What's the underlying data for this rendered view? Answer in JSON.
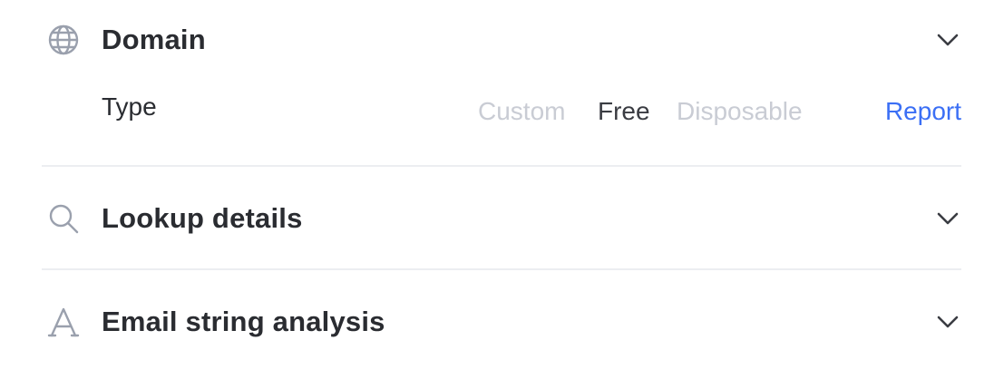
{
  "sections": [
    {
      "title": "Domain",
      "icon": "globe-icon",
      "expanded": true,
      "type_row": {
        "label": "Type",
        "options": [
          {
            "label": "Custom",
            "active": false
          },
          {
            "label": "Free",
            "active": true
          },
          {
            "label": "Disposable",
            "active": false
          }
        ],
        "action_label": "Report"
      }
    },
    {
      "title": "Lookup details",
      "icon": "search-icon",
      "expanded": false
    },
    {
      "title": "Email string analysis",
      "icon": "letter-a-icon",
      "expanded": false
    }
  ],
  "colors": {
    "icon": "#9aa0ad",
    "title": "#2a2c31",
    "inactive_option": "#c9ccd4",
    "active_option": "#3a3c42",
    "link": "#3b6ff5",
    "divider": "#eceef1"
  }
}
